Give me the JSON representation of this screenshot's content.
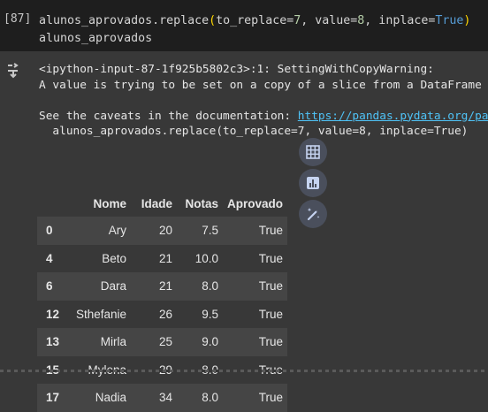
{
  "input_cell": {
    "execution_count": "[87]",
    "code_line1_pre": "alunos_aprovados.replace",
    "code_line1_open": "(",
    "code_line1_arg1": "to_replace=",
    "code_line1_val1": "7",
    "code_line1_arg2": ", value=",
    "code_line1_val2": "8",
    "code_line1_arg3": ", inplace=",
    "code_line1_val3": "True",
    "code_line1_close": ")",
    "code_line2": "alunos_aprovados"
  },
  "output": {
    "icon": "output-toggle-icon",
    "warning_line1": "<ipython-input-87-1f925b5802c3>:1: SettingWithCopyWarning:",
    "warning_line2": "A value is trying to be set on a copy of a slice from a DataFrame",
    "warning_line3_text": "See the caveats in the documentation: ",
    "warning_link": "https://pandas.pydata.org/pa",
    "warning_line4": "  alunos_aprovados.replace(to_replace=7, value=8, inplace=True)"
  },
  "dataframe": {
    "columns": [
      "Nome",
      "Idade",
      "Notas",
      "Aprovado"
    ],
    "rows": [
      {
        "index": "0",
        "Nome": "Ary",
        "Idade": "20",
        "Notas": "7.5",
        "Aprovado": "True"
      },
      {
        "index": "4",
        "Nome": "Beto",
        "Idade": "21",
        "Notas": "10.0",
        "Aprovado": "True"
      },
      {
        "index": "6",
        "Nome": "Dara",
        "Idade": "21",
        "Notas": "8.0",
        "Aprovado": "True"
      },
      {
        "index": "12",
        "Nome": "Sthefanie",
        "Idade": "26",
        "Notas": "9.5",
        "Aprovado": "True"
      },
      {
        "index": "13",
        "Nome": "Mirla",
        "Idade": "25",
        "Notas": "9.0",
        "Aprovado": "True"
      },
      {
        "index": "15",
        "Nome": "Mylena",
        "Idade": "29",
        "Notas": "8.0",
        "Aprovado": "True"
      },
      {
        "index": "17",
        "Nome": "Nadia",
        "Idade": "34",
        "Notas": "8.0",
        "Aprovado": "True"
      }
    ]
  },
  "actions": {
    "table_icon": "table-icon",
    "chart_icon": "bar-chart-icon",
    "magic_icon": "magic-wand-icon"
  },
  "colors": {
    "input_bg": "#1e1e1e",
    "output_bg": "#383838",
    "number": "#b5cea8",
    "keyword": "#569cd6",
    "link": "#4fc3f7",
    "button_bg": "#4a4f5c"
  }
}
